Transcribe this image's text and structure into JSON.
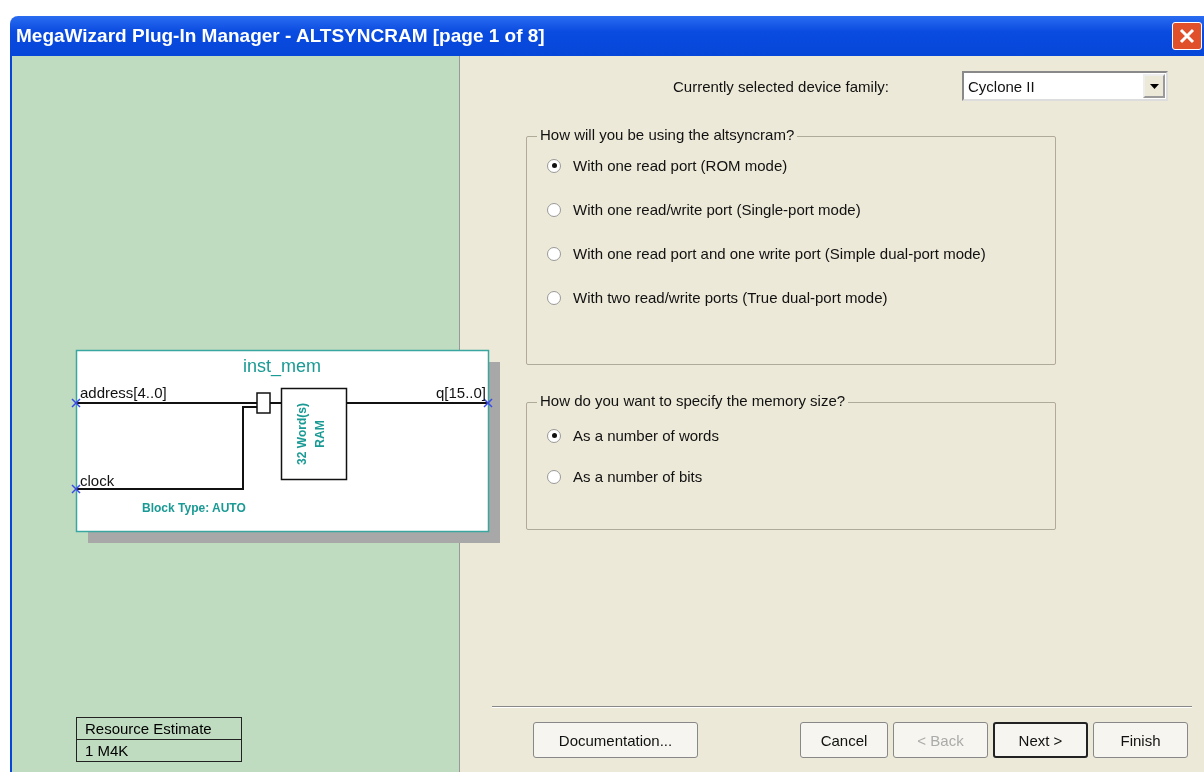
{
  "window": {
    "title": "MegaWizard Plug-In Manager - ALTSYNCRAM [page 1 of 8]"
  },
  "diagram": {
    "instance": "inst_mem",
    "inputs": [
      "address[4..0]",
      "clock"
    ],
    "output": "q[15..0]",
    "memory_lines": [
      "32 Word(s)",
      "RAM"
    ],
    "block_type": "Block Type: AUTO"
  },
  "resource_estimate": {
    "header": "Resource Estimate",
    "value": "1 M4K"
  },
  "device_family": {
    "label": "Currently selected device family:",
    "value": "Cyclone II"
  },
  "groups": [
    {
      "title": "How will you be using the altsyncram?",
      "options": [
        {
          "label": "With one read port (ROM mode)",
          "selected": true
        },
        {
          "label": "With one read/write port (Single-port mode)",
          "selected": false
        },
        {
          "label": "With one read port and one write port (Simple dual-port mode)",
          "selected": false
        },
        {
          "label": "With two read/write ports (True dual-port mode)",
          "selected": false
        }
      ]
    },
    {
      "title": "How do you want to specify the memory size?",
      "options": [
        {
          "label": "As a number of words",
          "selected": true
        },
        {
          "label": "As a number of bits",
          "selected": false
        }
      ]
    }
  ],
  "buttons": [
    {
      "label": "Documentation...",
      "disabled": false,
      "default": false
    },
    {
      "label": "Cancel",
      "disabled": false,
      "default": false
    },
    {
      "label": "< Back",
      "disabled": true,
      "default": false
    },
    {
      "label": "Next >",
      "disabled": false,
      "default": true
    },
    {
      "label": "Finish",
      "disabled": false,
      "default": false
    }
  ]
}
